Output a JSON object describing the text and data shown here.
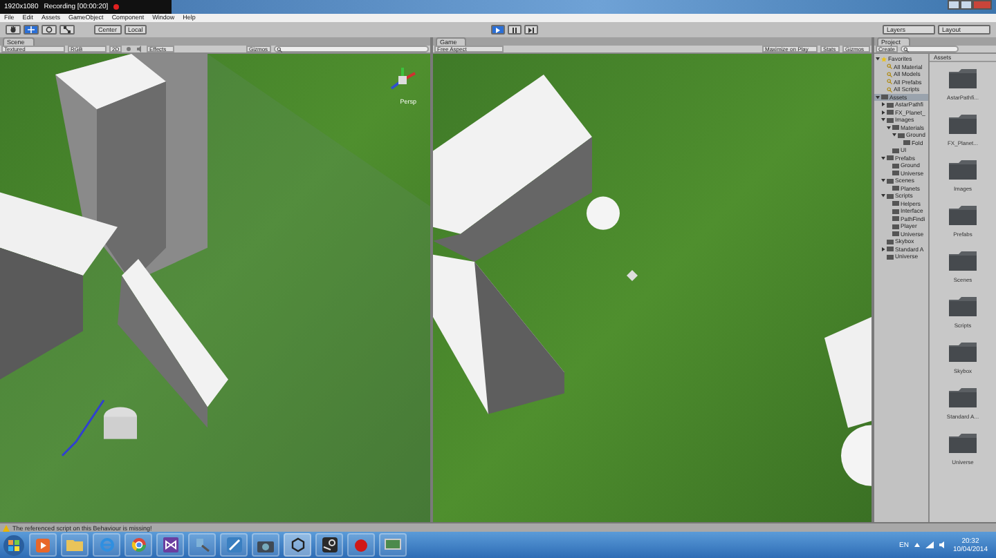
{
  "recorder": {
    "resolution": "1920x1080",
    "status": "Recording [00:00:20]"
  },
  "menu": [
    "File",
    "Edit",
    "Assets",
    "GameObject",
    "Component",
    "Window",
    "Help"
  ],
  "toolbar": {
    "pivot": "Center",
    "space": "Local",
    "playing": true,
    "layers": "Layers",
    "layout": "Layout"
  },
  "scene": {
    "tab": "Scene",
    "shading": "Textured",
    "render": "RGB",
    "mode_2d": "2D",
    "effects": "Effects",
    "gizmos": "Gizmos",
    "gizmo_label": "Persp"
  },
  "game": {
    "tab": "Game",
    "aspect": "Free Aspect",
    "maximize": "Maximize on Play",
    "stats": "Stats",
    "gizmos": "Gizmos"
  },
  "project": {
    "tab": "Project",
    "create": "Create",
    "breadcrumb": "Assets",
    "tree": [
      {
        "label": "Favorites",
        "kind": "favorites",
        "expanded": true,
        "children": [
          {
            "label": "All Material",
            "kind": "search"
          },
          {
            "label": "All Models",
            "kind": "search"
          },
          {
            "label": "All Prefabs",
            "kind": "search"
          },
          {
            "label": "All Scripts",
            "kind": "search"
          }
        ]
      },
      {
        "label": "Assets",
        "kind": "folder",
        "expanded": true,
        "children": [
          {
            "label": "AstarPathfi",
            "kind": "folder",
            "expanded": false
          },
          {
            "label": "FX_Planet_",
            "kind": "folder",
            "expanded": false
          },
          {
            "label": "Images",
            "kind": "folder",
            "expanded": true,
            "children": [
              {
                "label": "Materials",
                "kind": "folder",
                "expanded": true,
                "children": [
                  {
                    "label": "Ground",
                    "kind": "folder",
                    "expanded": true,
                    "children": [
                      {
                        "label": "Fold",
                        "kind": "leaf"
                      }
                    ]
                  }
                ]
              },
              {
                "label": "UI",
                "kind": "leaf"
              }
            ]
          },
          {
            "label": "Prefabs",
            "kind": "folder",
            "expanded": true,
            "children": [
              {
                "label": "Ground",
                "kind": "leaf"
              },
              {
                "label": "Universe",
                "kind": "leaf"
              }
            ]
          },
          {
            "label": "Scenes",
            "kind": "folder",
            "expanded": true,
            "children": [
              {
                "label": "Planets",
                "kind": "leaf"
              }
            ]
          },
          {
            "label": "Scripts",
            "kind": "folder",
            "expanded": true,
            "children": [
              {
                "label": "Helpers",
                "kind": "leaf"
              },
              {
                "label": "Interface",
                "kind": "leaf"
              },
              {
                "label": "PathFindi",
                "kind": "leaf"
              },
              {
                "label": "Player",
                "kind": "leaf"
              },
              {
                "label": "Universe",
                "kind": "leaf"
              }
            ]
          },
          {
            "label": "Skybox",
            "kind": "leaf"
          },
          {
            "label": "Standard A",
            "kind": "folder",
            "expanded": false
          },
          {
            "label": "Universe",
            "kind": "leaf"
          }
        ]
      }
    ],
    "folders": [
      "AstarPathfi...",
      "FX_Planet...",
      "Images",
      "Prefabs",
      "Scenes",
      "Scripts",
      "Skybox",
      "Standard A...",
      "Universe"
    ]
  },
  "status": "The referenced script on this Behaviour is missing!",
  "taskbar": {
    "apps": [
      {
        "kind": "media"
      },
      {
        "kind": "folder"
      },
      {
        "kind": "ie"
      },
      {
        "kind": "chrome"
      },
      {
        "kind": "vs"
      },
      {
        "kind": "tool"
      },
      {
        "kind": "pen"
      },
      {
        "kind": "camera"
      },
      {
        "kind": "unity"
      },
      {
        "kind": "steam"
      },
      {
        "kind": "record"
      },
      {
        "kind": "monitor"
      }
    ],
    "language": "EN",
    "time": "20:32",
    "date": "10/04/2014"
  }
}
